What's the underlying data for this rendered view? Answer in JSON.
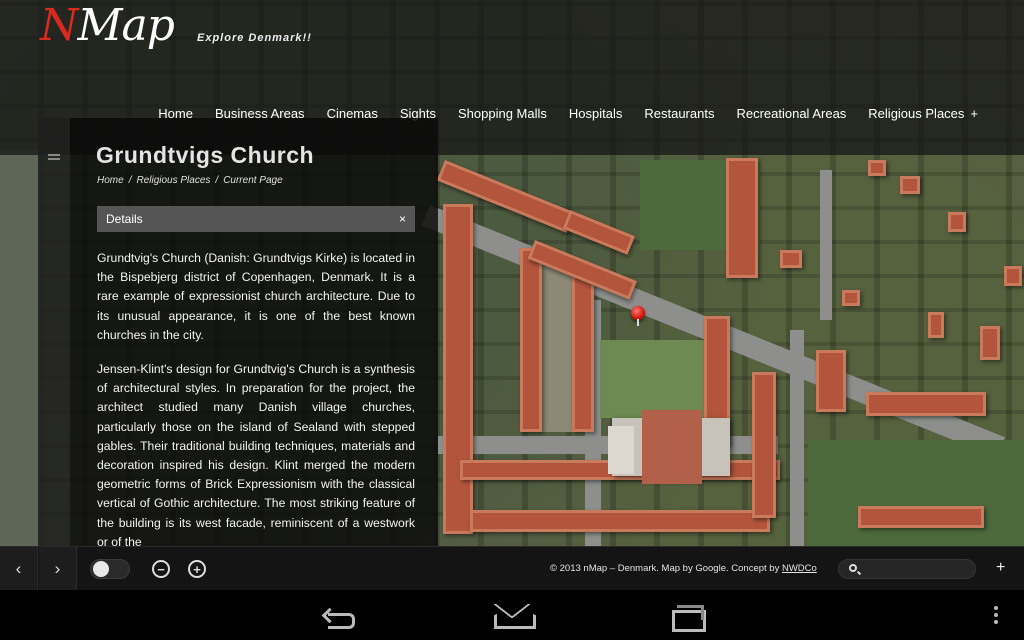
{
  "header": {
    "logo_text_n": "N",
    "logo_text_rest": "Map",
    "tagline": "Explore Denmark!!",
    "nav": [
      {
        "label": "Home"
      },
      {
        "label": "Business Areas"
      },
      {
        "label": "Cinemas"
      },
      {
        "label": "Sights"
      },
      {
        "label": "Shopping Malls"
      },
      {
        "label": "Hospitals"
      },
      {
        "label": "Restaurants"
      },
      {
        "label": "Recreational Areas"
      },
      {
        "label": "Religious Places",
        "expand": "+"
      }
    ]
  },
  "panel": {
    "title": "Grundtvigs Church",
    "breadcrumb": [
      "Home",
      "Religious Places",
      "Current Page"
    ],
    "breadcrumb_sep": "/",
    "details_label": "Details",
    "close_glyph": "×",
    "paragraphs": [
      "Grundtvig's Church (Danish: Grundtvigs Kirke) is located in the Bispebjerg district of Copenhagen, Denmark. It is a rare example of expressionist church architecture. Due to its unusual appearance, it is one of the best known churches in the city.",
      "Jensen-Klint's design for Grundtvig's Church is a synthesis of architectural styles. In preparation for the project, the architect studied many Danish village churches, particularly those on the island of Sealand with stepped gables. Their traditional building techniques, materials and decoration inspired his design. Klint merged the modern geometric forms of Brick Expressionism with the classical vertical of Gothic architecture. The most striking feature of the building is its west facade, reminiscent of a westwork or of the"
    ]
  },
  "toolbar": {
    "prev_glyph": "‹",
    "next_glyph": "›",
    "zoom_out_glyph": "−",
    "zoom_in_glyph": "+",
    "copyright_text": "© 2013 nMap – Denmark. Map by Google. Concept by ",
    "copyright_link": "NWDCo",
    "search_placeholder": "",
    "plus_glyph": "+"
  },
  "colors": {
    "logo_accent": "#d92a1f",
    "marker": "#d0140b",
    "details_bar": "#555555"
  },
  "icons": [
    "search-icon",
    "zoom-out-icon",
    "zoom-in-icon",
    "back-icon",
    "home-icon",
    "recent-apps-icon",
    "overflow-menu-icon",
    "map-marker-icon"
  ]
}
